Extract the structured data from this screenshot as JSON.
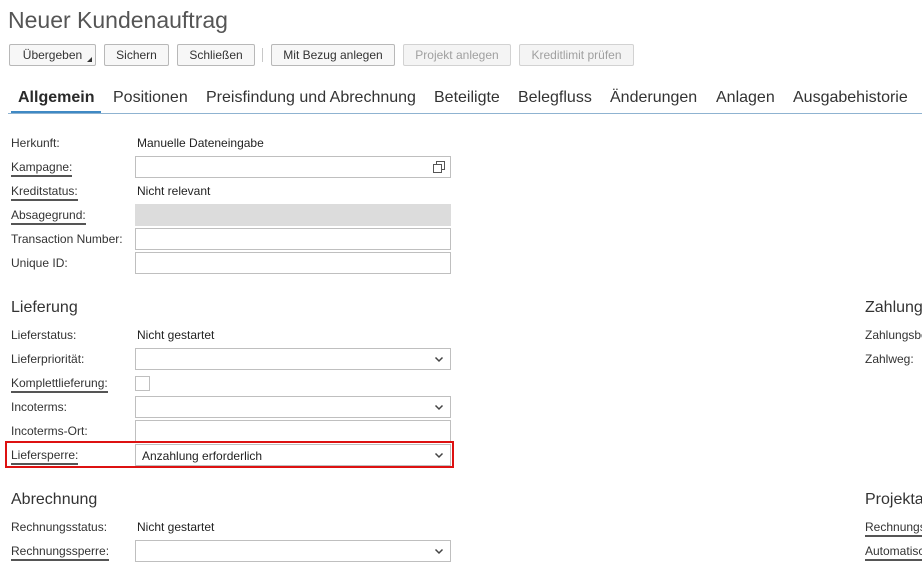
{
  "page": {
    "title": "Neuer Kundenauftrag"
  },
  "toolbar": {
    "submit": "Übergeben",
    "save": "Sichern",
    "close": "Schließen",
    "create_with_reference": "Mit Bezug anlegen",
    "create_project": "Projekt anlegen",
    "check_credit_limit": "Kreditlimit prüfen"
  },
  "tabs": [
    "Allgemein",
    "Positionen",
    "Preisfindung und Abrechnung",
    "Beteiligte",
    "Belegfluss",
    "Änderungen",
    "Anlagen",
    "Ausgabehistorie"
  ],
  "general": {
    "origin_label": "Herkunft:",
    "origin_value": "Manuelle Dateneingabe",
    "campaign_label": "Kampagne:",
    "campaign_value": "",
    "credit_status_label": "Kreditstatus:",
    "credit_status_value": "Nicht relevant",
    "rejection_reason_label": "Absagegrund:",
    "transaction_number_label": "Transaction Number:",
    "transaction_number_value": "",
    "unique_id_label": "Unique ID:",
    "unique_id_value": ""
  },
  "delivery": {
    "heading": "Lieferung",
    "status_label": "Lieferstatus:",
    "status_value": "Nicht gestartet",
    "priority_label": "Lieferpriorität:",
    "priority_value": "",
    "complete_label": "Komplettlieferung:",
    "complete_checked": false,
    "incoterms_label": "Incoterms:",
    "incoterms_value": "",
    "incoterms_location_label": "Incoterms-Ort:",
    "incoterms_location_value": "",
    "block_label": "Liefersperre:",
    "block_value": "Anzahlung erforderlich"
  },
  "billing": {
    "heading": "Abrechnung",
    "status_label": "Rechnungsstatus:",
    "status_value": "Nicht gestartet",
    "block_label": "Rechnungssperre:",
    "block_value": ""
  },
  "payment": {
    "heading": "Zahlung",
    "terms_label": "Zahlungsbe",
    "method_label": "Zahlweg:"
  },
  "project": {
    "heading": "Projekta",
    "billing_label": "Rechnungs",
    "automatic_label": "Automatisc"
  },
  "colors": {
    "accent": "#3f89c4",
    "highlight": "#dd1111",
    "disabled_field": "#dcdcdc"
  }
}
